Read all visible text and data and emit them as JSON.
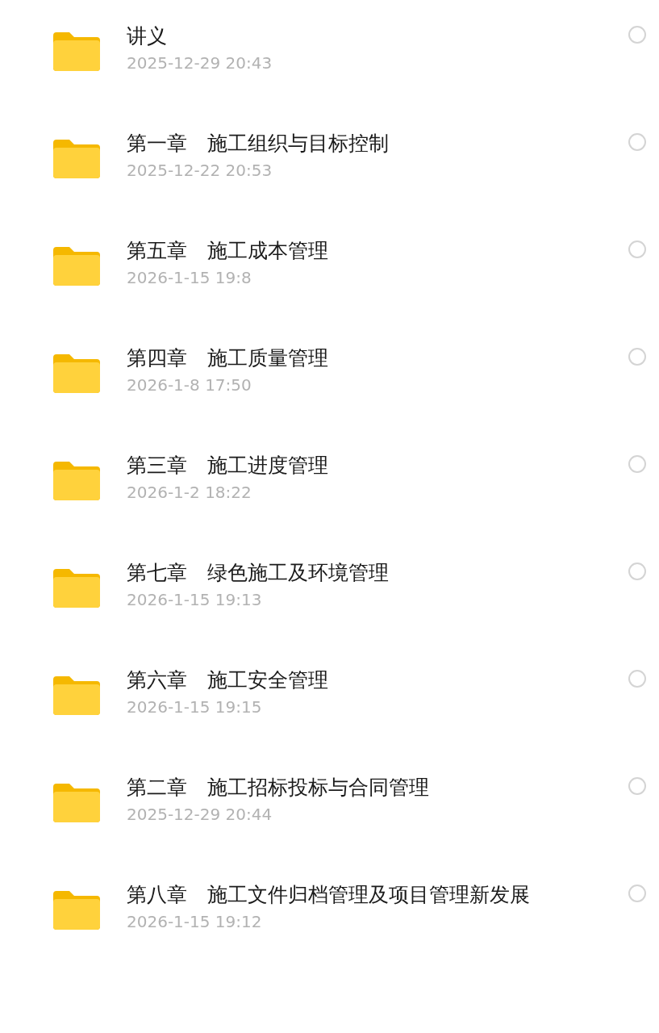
{
  "folders": [
    {
      "name": "讲义",
      "modified": "2025-12-29 20:43",
      "selected": false
    },
    {
      "name": "第一章　施工组织与目标控制",
      "modified": "2025-12-22 20:53",
      "selected": false
    },
    {
      "name": "第五章　施工成本管理",
      "modified": "2026-1-15 19:8",
      "selected": false
    },
    {
      "name": "第四章　施工质量管理",
      "modified": "2026-1-8 17:50",
      "selected": false
    },
    {
      "name": "第三章　施工进度管理",
      "modified": "2026-1-2 18:22",
      "selected": false
    },
    {
      "name": "第七章　绿色施工及环境管理",
      "modified": "2026-1-15 19:13",
      "selected": false
    },
    {
      "name": "第六章　施工安全管理",
      "modified": "2026-1-15 19:15",
      "selected": false
    },
    {
      "name": "第二章　施工招标投标与合同管理",
      "modified": "2025-12-29 20:44",
      "selected": false
    },
    {
      "name": "第八章　施工文件归档管理及项目管理新发展",
      "modified": "2026-1-15 19:12",
      "selected": false
    }
  ]
}
